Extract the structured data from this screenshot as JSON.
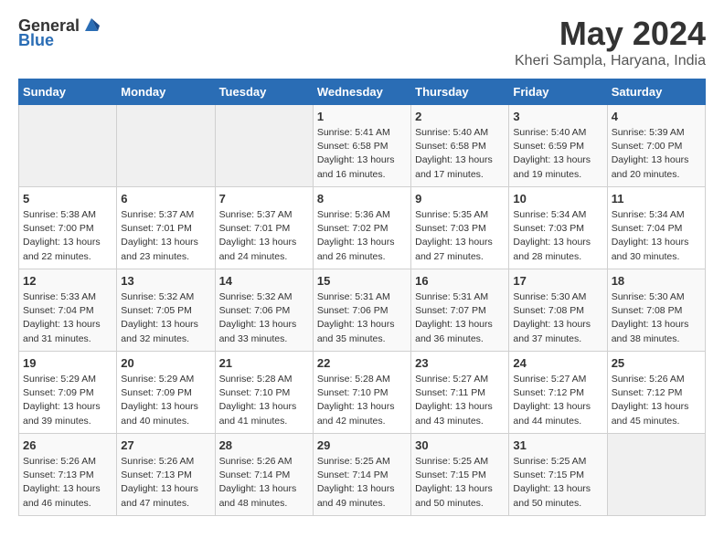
{
  "header": {
    "logo_general": "General",
    "logo_blue": "Blue",
    "month_year": "May 2024",
    "location": "Kheri Sampla, Haryana, India"
  },
  "days_of_week": [
    "Sunday",
    "Monday",
    "Tuesday",
    "Wednesday",
    "Thursday",
    "Friday",
    "Saturday"
  ],
  "weeks": [
    [
      {
        "num": "",
        "sunrise": "",
        "sunset": "",
        "daylight": "",
        "empty": true
      },
      {
        "num": "",
        "sunrise": "",
        "sunset": "",
        "daylight": "",
        "empty": true
      },
      {
        "num": "",
        "sunrise": "",
        "sunset": "",
        "daylight": "",
        "empty": true
      },
      {
        "num": "1",
        "sunrise": "Sunrise: 5:41 AM",
        "sunset": "Sunset: 6:58 PM",
        "daylight": "Daylight: 13 hours and 16 minutes."
      },
      {
        "num": "2",
        "sunrise": "Sunrise: 5:40 AM",
        "sunset": "Sunset: 6:58 PM",
        "daylight": "Daylight: 13 hours and 17 minutes."
      },
      {
        "num": "3",
        "sunrise": "Sunrise: 5:40 AM",
        "sunset": "Sunset: 6:59 PM",
        "daylight": "Daylight: 13 hours and 19 minutes."
      },
      {
        "num": "4",
        "sunrise": "Sunrise: 5:39 AM",
        "sunset": "Sunset: 7:00 PM",
        "daylight": "Daylight: 13 hours and 20 minutes."
      }
    ],
    [
      {
        "num": "5",
        "sunrise": "Sunrise: 5:38 AM",
        "sunset": "Sunset: 7:00 PM",
        "daylight": "Daylight: 13 hours and 22 minutes."
      },
      {
        "num": "6",
        "sunrise": "Sunrise: 5:37 AM",
        "sunset": "Sunset: 7:01 PM",
        "daylight": "Daylight: 13 hours and 23 minutes."
      },
      {
        "num": "7",
        "sunrise": "Sunrise: 5:37 AM",
        "sunset": "Sunset: 7:01 PM",
        "daylight": "Daylight: 13 hours and 24 minutes."
      },
      {
        "num": "8",
        "sunrise": "Sunrise: 5:36 AM",
        "sunset": "Sunset: 7:02 PM",
        "daylight": "Daylight: 13 hours and 26 minutes."
      },
      {
        "num": "9",
        "sunrise": "Sunrise: 5:35 AM",
        "sunset": "Sunset: 7:03 PM",
        "daylight": "Daylight: 13 hours and 27 minutes."
      },
      {
        "num": "10",
        "sunrise": "Sunrise: 5:34 AM",
        "sunset": "Sunset: 7:03 PM",
        "daylight": "Daylight: 13 hours and 28 minutes."
      },
      {
        "num": "11",
        "sunrise": "Sunrise: 5:34 AM",
        "sunset": "Sunset: 7:04 PM",
        "daylight": "Daylight: 13 hours and 30 minutes."
      }
    ],
    [
      {
        "num": "12",
        "sunrise": "Sunrise: 5:33 AM",
        "sunset": "Sunset: 7:04 PM",
        "daylight": "Daylight: 13 hours and 31 minutes."
      },
      {
        "num": "13",
        "sunrise": "Sunrise: 5:32 AM",
        "sunset": "Sunset: 7:05 PM",
        "daylight": "Daylight: 13 hours and 32 minutes."
      },
      {
        "num": "14",
        "sunrise": "Sunrise: 5:32 AM",
        "sunset": "Sunset: 7:06 PM",
        "daylight": "Daylight: 13 hours and 33 minutes."
      },
      {
        "num": "15",
        "sunrise": "Sunrise: 5:31 AM",
        "sunset": "Sunset: 7:06 PM",
        "daylight": "Daylight: 13 hours and 35 minutes."
      },
      {
        "num": "16",
        "sunrise": "Sunrise: 5:31 AM",
        "sunset": "Sunset: 7:07 PM",
        "daylight": "Daylight: 13 hours and 36 minutes."
      },
      {
        "num": "17",
        "sunrise": "Sunrise: 5:30 AM",
        "sunset": "Sunset: 7:08 PM",
        "daylight": "Daylight: 13 hours and 37 minutes."
      },
      {
        "num": "18",
        "sunrise": "Sunrise: 5:30 AM",
        "sunset": "Sunset: 7:08 PM",
        "daylight": "Daylight: 13 hours and 38 minutes."
      }
    ],
    [
      {
        "num": "19",
        "sunrise": "Sunrise: 5:29 AM",
        "sunset": "Sunset: 7:09 PM",
        "daylight": "Daylight: 13 hours and 39 minutes."
      },
      {
        "num": "20",
        "sunrise": "Sunrise: 5:29 AM",
        "sunset": "Sunset: 7:09 PM",
        "daylight": "Daylight: 13 hours and 40 minutes."
      },
      {
        "num": "21",
        "sunrise": "Sunrise: 5:28 AM",
        "sunset": "Sunset: 7:10 PM",
        "daylight": "Daylight: 13 hours and 41 minutes."
      },
      {
        "num": "22",
        "sunrise": "Sunrise: 5:28 AM",
        "sunset": "Sunset: 7:10 PM",
        "daylight": "Daylight: 13 hours and 42 minutes."
      },
      {
        "num": "23",
        "sunrise": "Sunrise: 5:27 AM",
        "sunset": "Sunset: 7:11 PM",
        "daylight": "Daylight: 13 hours and 43 minutes."
      },
      {
        "num": "24",
        "sunrise": "Sunrise: 5:27 AM",
        "sunset": "Sunset: 7:12 PM",
        "daylight": "Daylight: 13 hours and 44 minutes."
      },
      {
        "num": "25",
        "sunrise": "Sunrise: 5:26 AM",
        "sunset": "Sunset: 7:12 PM",
        "daylight": "Daylight: 13 hours and 45 minutes."
      }
    ],
    [
      {
        "num": "26",
        "sunrise": "Sunrise: 5:26 AM",
        "sunset": "Sunset: 7:13 PM",
        "daylight": "Daylight: 13 hours and 46 minutes."
      },
      {
        "num": "27",
        "sunrise": "Sunrise: 5:26 AM",
        "sunset": "Sunset: 7:13 PM",
        "daylight": "Daylight: 13 hours and 47 minutes."
      },
      {
        "num": "28",
        "sunrise": "Sunrise: 5:26 AM",
        "sunset": "Sunset: 7:14 PM",
        "daylight": "Daylight: 13 hours and 48 minutes."
      },
      {
        "num": "29",
        "sunrise": "Sunrise: 5:25 AM",
        "sunset": "Sunset: 7:14 PM",
        "daylight": "Daylight: 13 hours and 49 minutes."
      },
      {
        "num": "30",
        "sunrise": "Sunrise: 5:25 AM",
        "sunset": "Sunset: 7:15 PM",
        "daylight": "Daylight: 13 hours and 50 minutes."
      },
      {
        "num": "31",
        "sunrise": "Sunrise: 5:25 AM",
        "sunset": "Sunset: 7:15 PM",
        "daylight": "Daylight: 13 hours and 50 minutes."
      },
      {
        "num": "",
        "sunrise": "",
        "sunset": "",
        "daylight": "",
        "empty": true
      }
    ]
  ]
}
